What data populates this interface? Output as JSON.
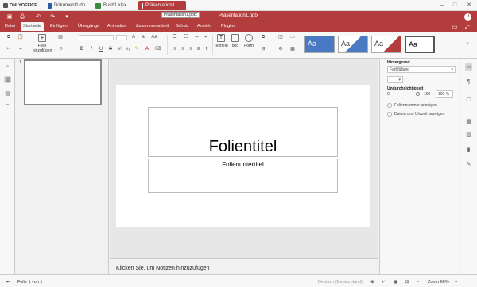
{
  "app": {
    "logo": "ONLYOFFICE"
  },
  "tabs": [
    {
      "label": "Dokument1.do...",
      "color": "#2c5aa0"
    },
    {
      "label": "Buch1.xlsx",
      "color": "#3a8a3e"
    },
    {
      "label": "Präsentation1....",
      "color": "#b33d3c"
    }
  ],
  "tooltip": "Präsentation1.pptx",
  "document_title": "Präsentation1.pptx",
  "avatar_initial": "U",
  "menu": [
    "Datei",
    "Startseite",
    "Einfügen",
    "Übergänge",
    "Animation",
    "Zusammenarbeit",
    "Schutz",
    "Ansicht",
    "Plugins"
  ],
  "toolbar": {
    "new_slide_line1": "Folie",
    "new_slide_line2": "hinzufügen",
    "textbox_label": "Textfeld",
    "image_label": "Bild",
    "shape_label": "Form"
  },
  "themes": [
    "Aa",
    "Aa",
    "Aa",
    "Aa"
  ],
  "slide_panel": {
    "number": "1"
  },
  "slide": {
    "title": "Folientitel",
    "subtitle": "Folienuntertitel"
  },
  "notes_placeholder": "Klicken Sie, um Notizen hinzuzufügen",
  "right_panel": {
    "background_label": "Hintergrund",
    "fill_value": "Farbfüllung",
    "opacity_label": "Undurchsichtigkeit",
    "opacity_min": "0",
    "opacity_max": "100",
    "opacity_value": "100 %",
    "slide_number_label": "Foliennummer anzeigen",
    "datetime_label": "Datum und Uhrzeit anzeigen"
  },
  "status": {
    "slide_of": "Folie 1 von 1",
    "language": "Deutsch (Deutschland)",
    "zoom": "Zoom 66%"
  },
  "colors": {
    "accent": "#b33d3c"
  }
}
